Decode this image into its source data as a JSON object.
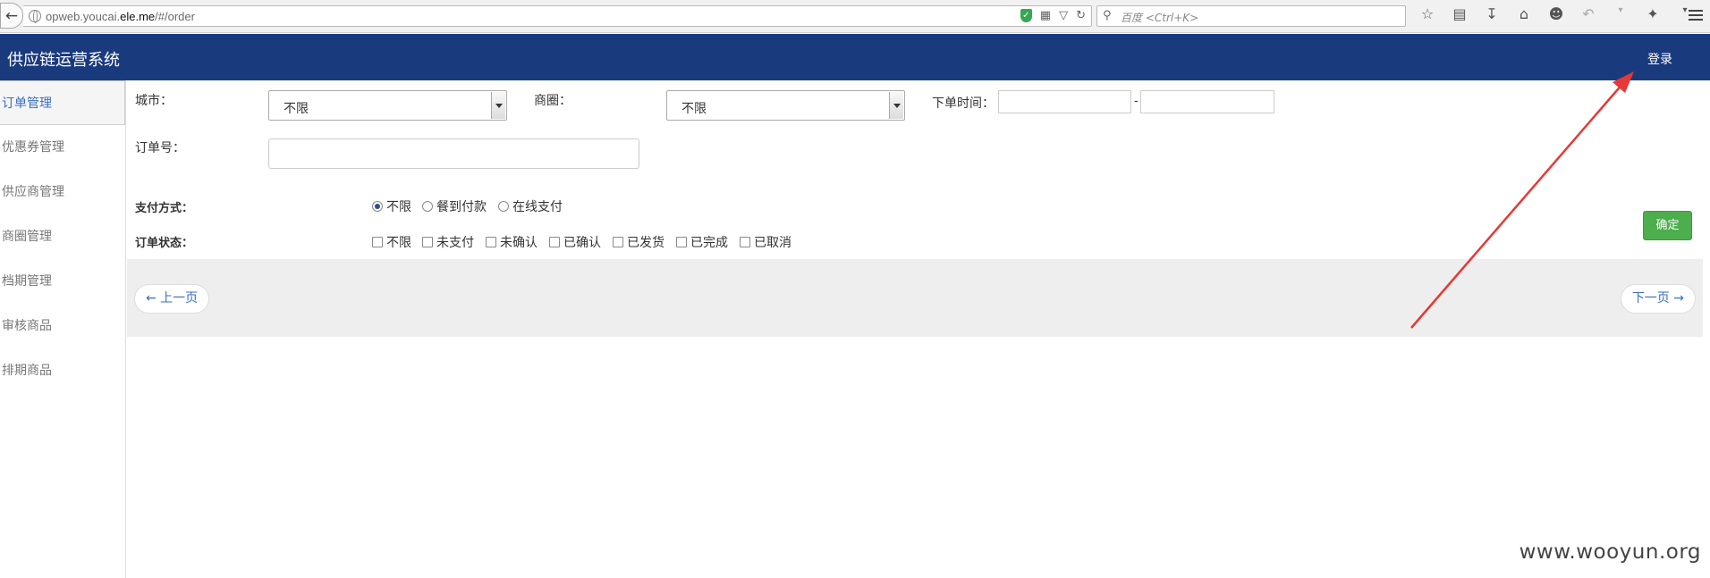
{
  "browser": {
    "url_prefix": "opweb.youcai.",
    "url_domain": "ele.me",
    "url_suffix": "/#/order",
    "search_placeholder": "百度 <Ctrl+K>"
  },
  "header": {
    "title": "供应链运营系统",
    "login": "登录"
  },
  "sidebar": {
    "items": [
      {
        "label": "订单管理"
      },
      {
        "label": "优惠券管理"
      },
      {
        "label": "供应商管理"
      },
      {
        "label": "商圈管理"
      },
      {
        "label": "档期管理"
      },
      {
        "label": "审核商品"
      },
      {
        "label": "排期商品"
      }
    ]
  },
  "filters": {
    "city_label": "城市：",
    "city_value": "不限",
    "district_label": "商圈：",
    "district_value": "不限",
    "time_label": "下单时间：",
    "time_separator": "-",
    "order_no_label": "订单号：",
    "payment_label": "支付方式：",
    "payment_options": [
      "不限",
      "餐到付款",
      "在线支付"
    ],
    "status_label": "订单状态：",
    "status_options": [
      "不限",
      "未支付",
      "未确认",
      "已确认",
      "已发货",
      "已完成",
      "已取消"
    ],
    "confirm": "确定"
  },
  "pager": {
    "prev": "← 上一页",
    "next": "下一页 →"
  },
  "watermark": "www.wooyun.org",
  "colors": {
    "header_bg": "#1a3a7e",
    "confirm_bg": "#4cae4c",
    "link": "#3a6ebd",
    "annotation": "#e53935"
  }
}
